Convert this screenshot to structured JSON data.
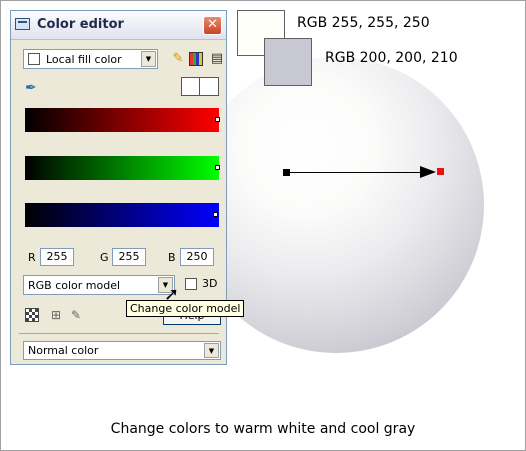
{
  "window": {
    "title": "Color editor",
    "close_glyph": "✕"
  },
  "toolbar": {
    "fill_dropdown": "Local fill color",
    "icons": [
      "tag-icon",
      "color-grid-icon",
      "panel-icon"
    ]
  },
  "eyedropper_icon": "eyedropper-icon",
  "sliders": [
    {
      "name": "red",
      "color": "#ff0000",
      "value": 255
    },
    {
      "name": "green",
      "color": "#00ff00",
      "value": 255
    },
    {
      "name": "blue",
      "color": "#0000ff",
      "value": 250
    }
  ],
  "components": {
    "r_label": "R",
    "r_value": "255",
    "g_label": "G",
    "g_value": "255",
    "b_label": "B",
    "b_value": "250"
  },
  "color_model": {
    "value": "RGB color model",
    "three_d_label": "3D",
    "three_d_checked": false
  },
  "tooltip": "Change color model",
  "help_label": "Help",
  "normal_color": "Normal color",
  "swatches": {
    "warm_label": "RGB 255, 255, 250",
    "warm_color": "#fffffa",
    "cool_label": "RGB 200, 200, 210",
    "cool_color": "#c8c8d2"
  },
  "caption": "Change colors to warm white and cool gray"
}
